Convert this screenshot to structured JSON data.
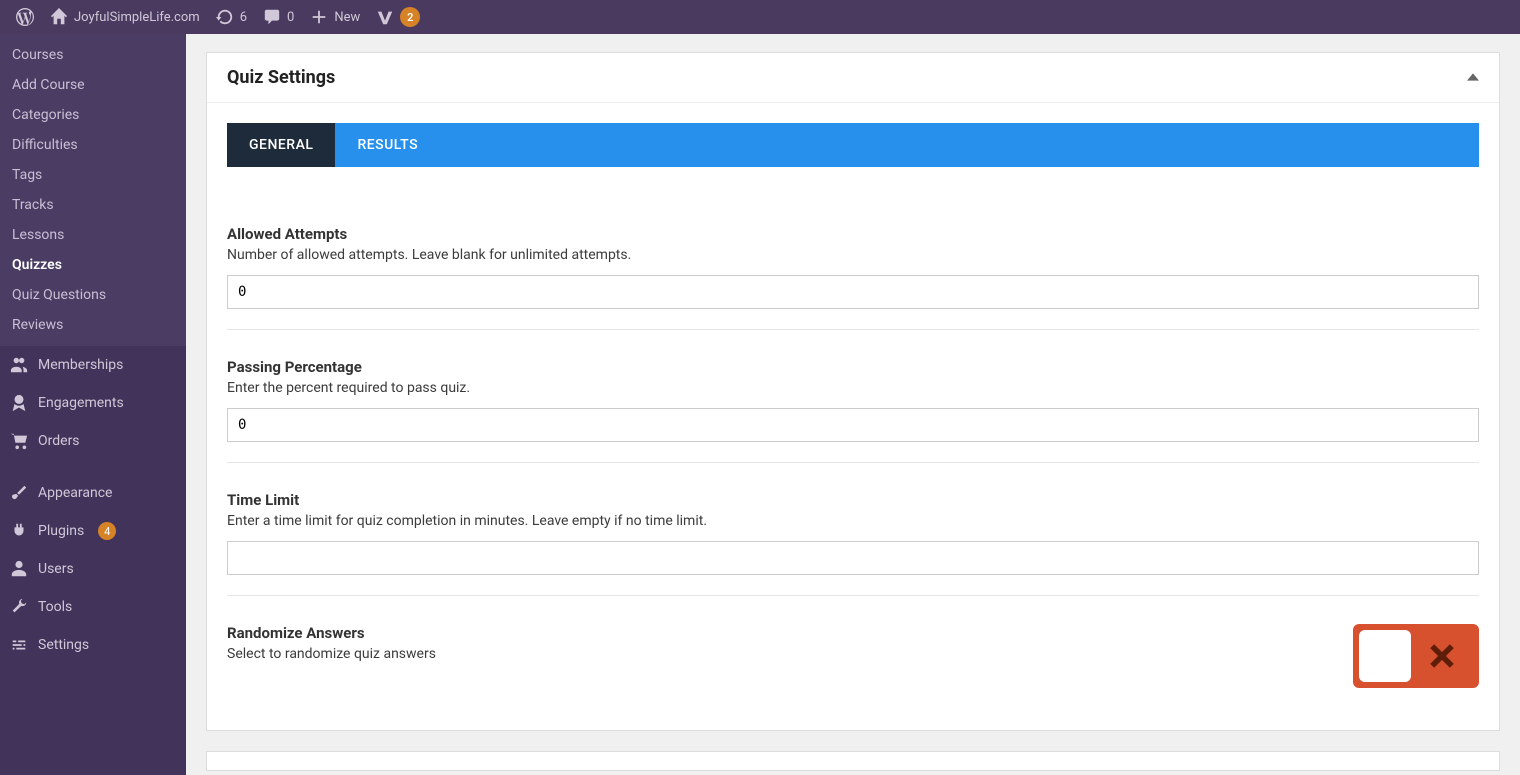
{
  "adminbar": {
    "site_name": "JoyfulSimpleLife.com",
    "refresh_count": "6",
    "comments_count": "0",
    "new_label": "New",
    "yoast_badge": "2"
  },
  "sidebar": {
    "submenu": [
      {
        "label": "Courses"
      },
      {
        "label": "Add Course"
      },
      {
        "label": "Categories"
      },
      {
        "label": "Difficulties"
      },
      {
        "label": "Tags"
      },
      {
        "label": "Tracks"
      },
      {
        "label": "Lessons"
      },
      {
        "label": "Quizzes",
        "current": true
      },
      {
        "label": "Quiz Questions"
      },
      {
        "label": "Reviews"
      }
    ],
    "main_menu": {
      "memberships": "Memberships",
      "engagements": "Engagements",
      "orders": "Orders",
      "appearance": "Appearance",
      "plugins": "Plugins",
      "plugins_badge": "4",
      "users": "Users",
      "tools": "Tools",
      "settings": "Settings"
    }
  },
  "panel": {
    "title": "Quiz Settings",
    "tabs": {
      "general": "GENERAL",
      "results": "RESULTS"
    },
    "fields": {
      "attempts": {
        "label": "Allowed Attempts",
        "desc": "Number of allowed attempts. Leave blank for unlimited attempts.",
        "value": "0"
      },
      "passing": {
        "label": "Passing Percentage",
        "desc": "Enter the percent required to pass quiz.",
        "value": "0"
      },
      "timelimit": {
        "label": "Time Limit",
        "desc": "Enter a time limit for quiz completion in minutes. Leave empty if no time limit.",
        "value": ""
      },
      "randomize": {
        "label": "Randomize Answers",
        "desc": "Select to randomize quiz answers"
      }
    }
  }
}
